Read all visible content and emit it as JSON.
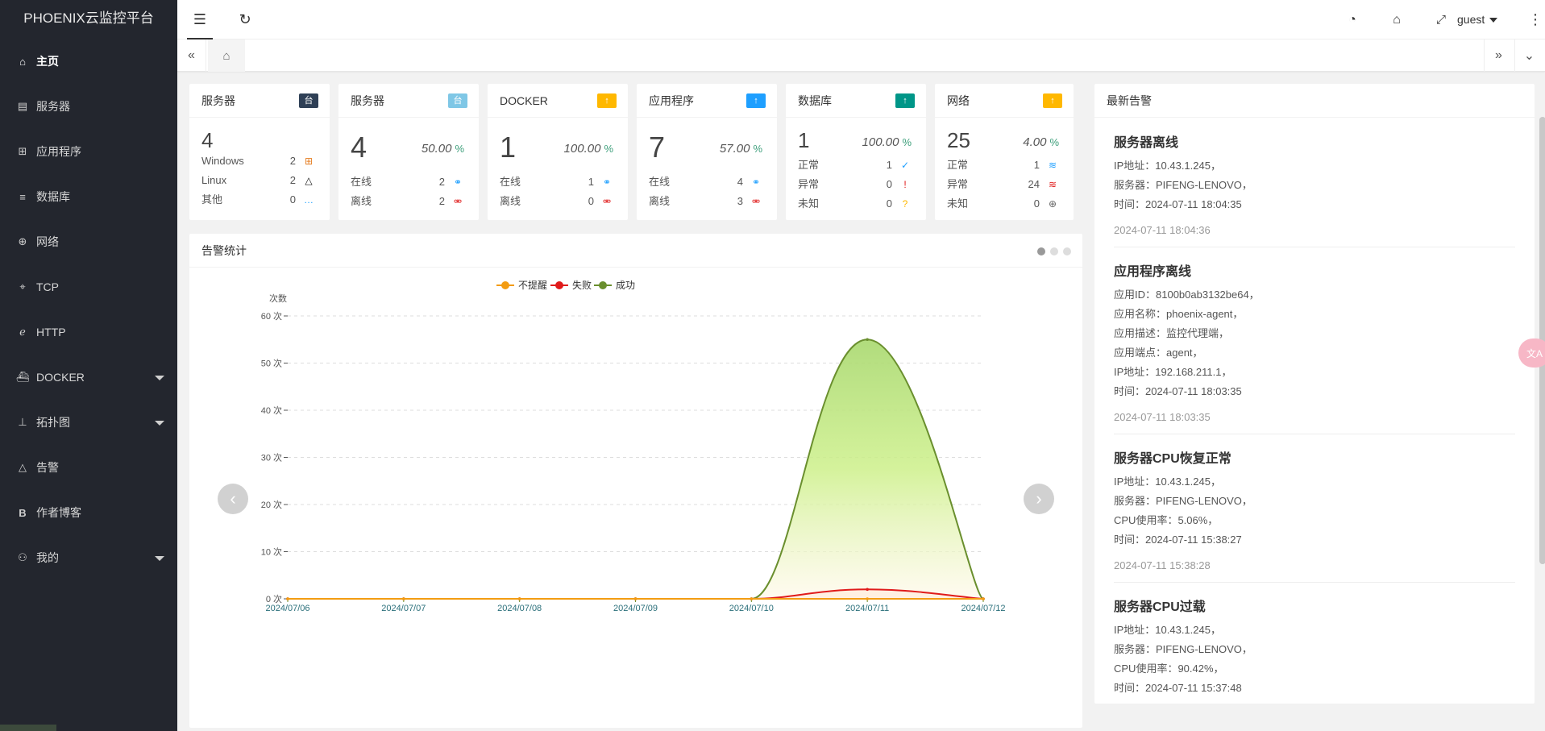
{
  "app": {
    "title": "PHOENIX云监控平台"
  },
  "sidebar": {
    "items": [
      {
        "label": "主页",
        "icon": "home-icon"
      },
      {
        "label": "服务器",
        "icon": "server-icon"
      },
      {
        "label": "应用程序",
        "icon": "app-icon"
      },
      {
        "label": "数据库",
        "icon": "database-icon"
      },
      {
        "label": "网络",
        "icon": "globe-icon"
      },
      {
        "label": "TCP",
        "icon": "tcp-icon"
      },
      {
        "label": "HTTP",
        "icon": "ie-icon"
      },
      {
        "label": "DOCKER",
        "icon": "docker-icon"
      },
      {
        "label": "拓扑图",
        "icon": "topology-icon"
      },
      {
        "label": "告警",
        "icon": "bell-icon"
      },
      {
        "label": "作者博客",
        "icon": "blog-icon"
      },
      {
        "label": "我的",
        "icon": "user-icon"
      }
    ]
  },
  "header": {
    "user": "guest"
  },
  "stats": {
    "server_os": {
      "title": "服务器",
      "badge": "台",
      "badge_color": "#2f4056",
      "total": "4",
      "rows": [
        {
          "label": "Windows",
          "value": "2"
        },
        {
          "label": "Linux",
          "value": "2"
        },
        {
          "label": "其他",
          "value": "0"
        }
      ]
    },
    "server": {
      "title": "服务器",
      "badge": "台",
      "badge_color": "#7fc7e6",
      "total": "4",
      "percent": "50.00",
      "unit": "%",
      "rows": [
        {
          "label": "在线",
          "value": "2"
        },
        {
          "label": "离线",
          "value": "2"
        }
      ]
    },
    "docker": {
      "title": "DOCKER",
      "badge": "↑",
      "badge_color": "#ffb800",
      "total": "1",
      "percent": "100.00",
      "unit": "%",
      "rows": [
        {
          "label": "在线",
          "value": "1"
        },
        {
          "label": "离线",
          "value": "0"
        }
      ]
    },
    "app": {
      "title": "应用程序",
      "badge": "↑",
      "badge_color": "#1e9fff",
      "total": "7",
      "percent": "57.00",
      "unit": "%",
      "rows": [
        {
          "label": "在线",
          "value": "4"
        },
        {
          "label": "离线",
          "value": "3"
        }
      ]
    },
    "db": {
      "title": "数据库",
      "badge": "↑",
      "badge_color": "#009688",
      "total": "1",
      "percent": "100.00",
      "unit": "%",
      "rows": [
        {
          "label": "正常",
          "value": "1"
        },
        {
          "label": "异常",
          "value": "0"
        },
        {
          "label": "未知",
          "value": "0"
        }
      ]
    },
    "net": {
      "title": "网络",
      "badge": "↑",
      "badge_color": "#ffb800",
      "total": "25",
      "percent": "4.00",
      "unit": "%",
      "rows": [
        {
          "label": "正常",
          "value": "1"
        },
        {
          "label": "异常",
          "value": "24"
        },
        {
          "label": "未知",
          "value": "0"
        }
      ]
    }
  },
  "chart_panel": {
    "title": "告警统计"
  },
  "chart_data": {
    "type": "area",
    "ylabel": "次数",
    "ylim": [
      0,
      60
    ],
    "yticks": [
      "0 次",
      "10 次",
      "20 次",
      "30 次",
      "40 次",
      "50 次",
      "60 次"
    ],
    "x": [
      "2024/07/06",
      "2024/07/07",
      "2024/07/08",
      "2024/07/09",
      "2024/07/10",
      "2024/07/11",
      "2024/07/12"
    ],
    "series": [
      {
        "name": "不提醒",
        "color": "#f39c12",
        "values": [
          0,
          0,
          0,
          0,
          0,
          0,
          0
        ]
      },
      {
        "name": "失败",
        "color": "#e01b1b",
        "values": [
          0,
          0,
          0,
          0,
          0,
          2,
          0
        ]
      },
      {
        "name": "成功",
        "color": "#6a8f2e",
        "values": [
          0,
          0,
          0,
          0,
          0,
          55,
          0
        ]
      }
    ],
    "grid": true,
    "legend": "top-center"
  },
  "alerts": {
    "title": "最新告警",
    "items": [
      {
        "title": "服务器离线",
        "lines": [
          "IP地址：10.43.1.245，",
          "服务器：PIFENG-LENOVO，",
          "时间：2024-07-11 18:04:35"
        ],
        "time": "2024-07-11 18:04:36"
      },
      {
        "title": "应用程序离线",
        "lines": [
          "应用ID：8100b0ab3132be64，",
          "应用名称：phoenix-agent，",
          "应用描述：监控代理端，",
          "应用端点：agent，",
          "IP地址：192.168.211.1，",
          "时间：2024-07-11 18:03:35"
        ],
        "time": "2024-07-11 18:03:35"
      },
      {
        "title": "服务器CPU恢复正常",
        "lines": [
          "IP地址：10.43.1.245，",
          "服务器：PIFENG-LENOVO，",
          "CPU使用率：5.06%，",
          "时间：2024-07-11 15:38:27"
        ],
        "time": "2024-07-11 15:38:28"
      },
      {
        "title": "服务器CPU过载",
        "lines": [
          "IP地址：10.43.1.245，",
          "服务器：PIFENG-LENOVO，",
          "CPU使用率：90.42%，",
          "时间：2024-07-11 15:37:48"
        ],
        "time": ""
      }
    ]
  }
}
